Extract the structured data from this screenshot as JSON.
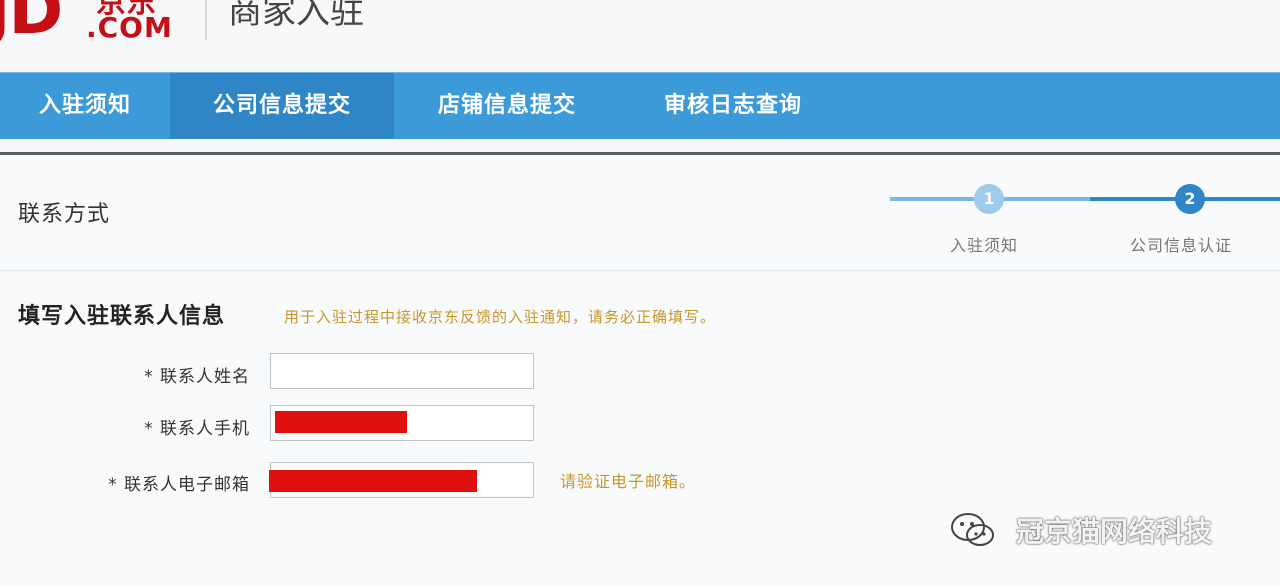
{
  "header": {
    "logo_text": "JD",
    "logo_cn": "京东",
    "logo_com": ".COM",
    "title": "商家入驻"
  },
  "nav": {
    "items": [
      {
        "label": "入驻须知",
        "active": false
      },
      {
        "label": "公司信息提交",
        "active": true
      },
      {
        "label": "店铺信息提交",
        "active": false
      },
      {
        "label": "审核日志查询",
        "active": false
      }
    ]
  },
  "section": {
    "title": "联系方式"
  },
  "steps": [
    {
      "number": "1",
      "label": "入驻须知"
    },
    {
      "number": "2",
      "label": "公司信息认证"
    }
  ],
  "form": {
    "heading": "填写入驻联系人信息",
    "hint": "用于入驻过程中接收京东反馈的入驻通知，请务必正确填写。",
    "fields": [
      {
        "label": "* 联系人姓名",
        "value": "",
        "redacted": false
      },
      {
        "label": "* 联系人手机",
        "value": "",
        "redacted": true
      },
      {
        "label": "* 联系人电子邮箱",
        "value": "",
        "redacted": true
      }
    ],
    "email_note": "请验证电子邮箱。"
  },
  "watermark": {
    "text": "冠京猫网络科技"
  },
  "colors": {
    "nav_bg": "#3d9ad8",
    "nav_active": "#2f86c7",
    "brand_red": "#c40f15",
    "hint_gold": "#c8962a",
    "redaction": "#e01010"
  }
}
